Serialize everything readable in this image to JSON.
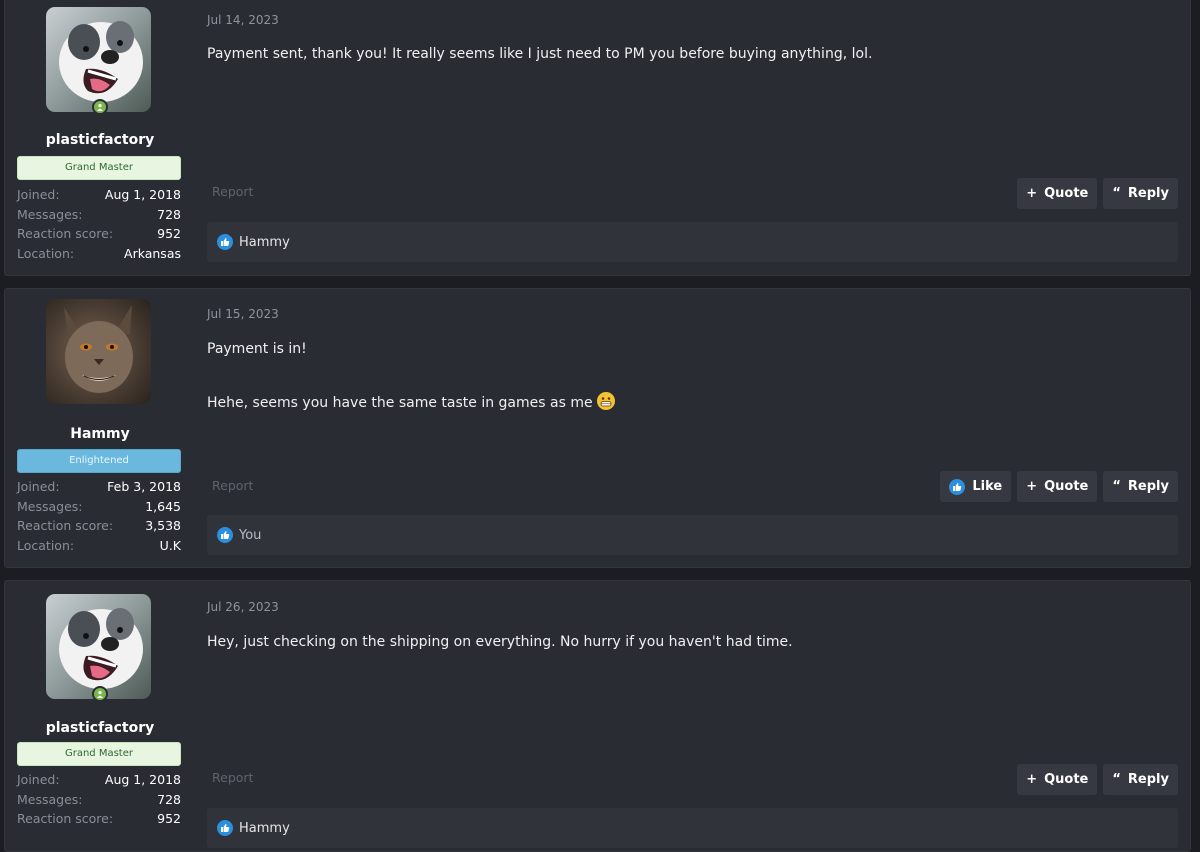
{
  "icons": {
    "online": "online-status-icon",
    "like": "thumbs-up-icon",
    "quote": "plus-icon",
    "reply": "quote-marks-icon",
    "emoji": "grinning-emoji-icon"
  },
  "colors": {
    "background": "#1b1d22",
    "post_bg": "#2a2c33",
    "like_blue": "#2b8fe0",
    "online_green": "#7ab648",
    "grand_master_badge": "#e7f5e1",
    "enlightened_badge": "#6ab8de"
  },
  "posts": [
    {
      "user": {
        "name": "plasticfactory",
        "title": "Grand Master",
        "stats": [
          {
            "label": "Joined:",
            "value": "Aug 1, 2018"
          },
          {
            "label": "Messages:",
            "value": "728"
          },
          {
            "label": "Reaction score:",
            "value": "952"
          },
          {
            "label": "Location:",
            "value": "Arkansas"
          }
        ]
      },
      "date": "Jul 14, 2023",
      "message": [
        "Payment sent, thank you! It really seems like I just need to PM you before buying anything, lol."
      ],
      "report": "Report",
      "actions": {
        "quote": "Quote",
        "reply": "Reply"
      },
      "reactions": "Hammy"
    },
    {
      "user": {
        "name": "Hammy",
        "title": "Enlightened",
        "stats": [
          {
            "label": "Joined:",
            "value": "Feb 3, 2018"
          },
          {
            "label": "Messages:",
            "value": "1,645"
          },
          {
            "label": "Reaction score:",
            "value": "3,538"
          },
          {
            "label": "Location:",
            "value": "U.K"
          }
        ]
      },
      "date": "Jul 15, 2023",
      "message": [
        "Payment is in!",
        "Hehe, seems you have the same taste in games as me"
      ],
      "report": "Report",
      "actions": {
        "like": "Like",
        "quote": "Quote",
        "reply": "Reply"
      },
      "reactions": "You"
    },
    {
      "user": {
        "name": "plasticfactory",
        "title": "Grand Master",
        "stats": [
          {
            "label": "Joined:",
            "value": "Aug 1, 2018"
          },
          {
            "label": "Messages:",
            "value": "728"
          },
          {
            "label": "Reaction score:",
            "value": "952"
          }
        ]
      },
      "date": "Jul 26, 2023",
      "message": [
        "Hey, just checking on the shipping on everything. No hurry if you haven't had time."
      ],
      "report": "Report",
      "actions": {
        "quote": "Quote",
        "reply": "Reply"
      },
      "reactions": "Hammy"
    }
  ]
}
